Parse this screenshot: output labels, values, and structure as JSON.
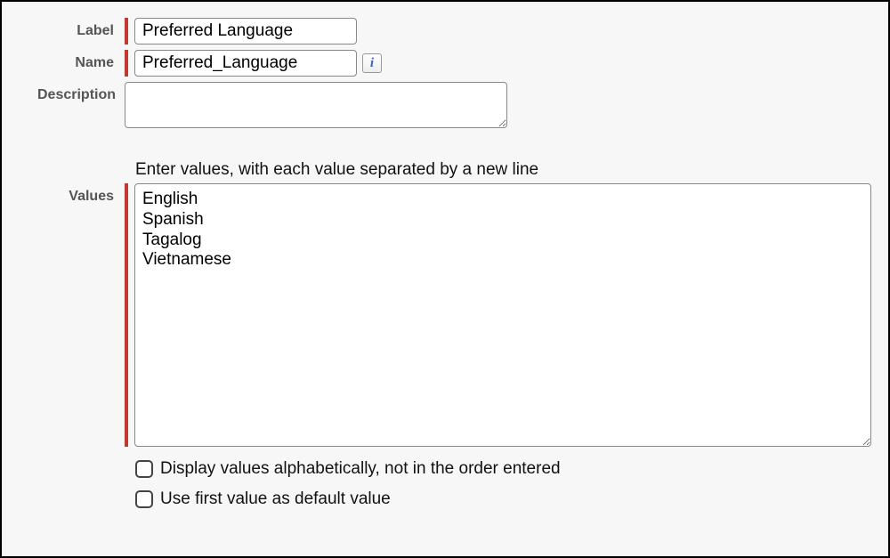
{
  "form": {
    "label_field_label": "Label",
    "label_value": "Preferred Language",
    "name_field_label": "Name",
    "name_value": "Preferred_Language",
    "info_icon_text": "i",
    "description_field_label": "Description",
    "description_value": "",
    "values_helper_text": "Enter values, with each value separated by a new line",
    "values_field_label": "Values",
    "values_text": "English\nSpanish\nTagalog\nVietnamese",
    "checkbox_alpha_label": "Display values alphabetically, not in the order entered",
    "checkbox_alpha_checked": false,
    "checkbox_default_label": "Use first value as default value",
    "checkbox_default_checked": false
  }
}
